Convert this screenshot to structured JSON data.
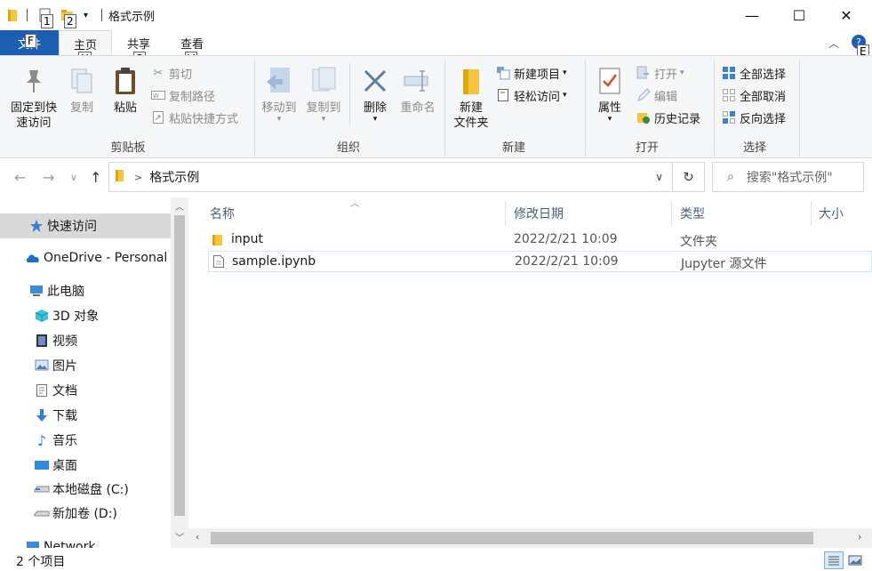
{
  "window": {
    "title": "格式示例",
    "controls": {
      "minimize": "—",
      "maximize": "☐",
      "close": "✕"
    }
  },
  "keytips": {
    "qa1": "1",
    "qa2": "2",
    "file": "F",
    "home": "H",
    "share": "S",
    "view": "V",
    "expand": "E"
  },
  "tabs": {
    "file": "文件",
    "home": "主页",
    "share": "共享",
    "view": "查看"
  },
  "ribbon": {
    "clipboard": {
      "label": "剪贴板",
      "pin": "固定到快\n速访问",
      "pin_l1": "固定到快",
      "pin_l2": "速访问",
      "copy": "复制",
      "paste": "粘贴",
      "cut": "剪切",
      "copy_path": "复制路径",
      "paste_shortcut": "粘贴快捷方式"
    },
    "organize": {
      "label": "组织",
      "move_to": "移动到",
      "copy_to": "复制到",
      "delete": "删除",
      "rename": "重命名"
    },
    "new": {
      "label": "新建",
      "new_folder_l1": "新建",
      "new_folder_l2": "文件夹",
      "new_item": "新建项目",
      "easy_access": "轻松访问"
    },
    "open": {
      "label": "打开",
      "properties": "属性",
      "open": "打开",
      "edit": "编辑",
      "history": "历史记录"
    },
    "select": {
      "label": "选择",
      "select_all": "全部选择",
      "select_none": "全部取消",
      "invert": "反向选择"
    }
  },
  "address": {
    "path": "格式示例",
    "search_placeholder": "搜索\"格式示例\""
  },
  "navpane": {
    "items": [
      {
        "label": "快速访问"
      },
      {
        "label": "OneDrive - Personal"
      },
      {
        "label": "此电脑"
      },
      {
        "label": "3D 对象"
      },
      {
        "label": "视频"
      },
      {
        "label": "图片"
      },
      {
        "label": "文档"
      },
      {
        "label": "下载"
      },
      {
        "label": "音乐"
      },
      {
        "label": "桌面"
      },
      {
        "label": "本地磁盘 (C:)"
      },
      {
        "label": "新加卷 (D:)"
      },
      {
        "label": "Network"
      }
    ]
  },
  "filelist": {
    "columns": {
      "name": "名称",
      "modified": "修改日期",
      "type": "类型",
      "size": "大小"
    },
    "rows": [
      {
        "name": "input",
        "modified": "2022/2/21 10:09",
        "type": "文件夹"
      },
      {
        "name": "sample.ipynb",
        "modified": "2022/2/21 10:09",
        "type": "Jupyter 源文件"
      }
    ]
  },
  "status": {
    "count": "2 个项目"
  },
  "colors": {
    "file_tab": "#1c5fb0",
    "folder_yellow": "#f4c542",
    "selection": "#cde8ff"
  }
}
